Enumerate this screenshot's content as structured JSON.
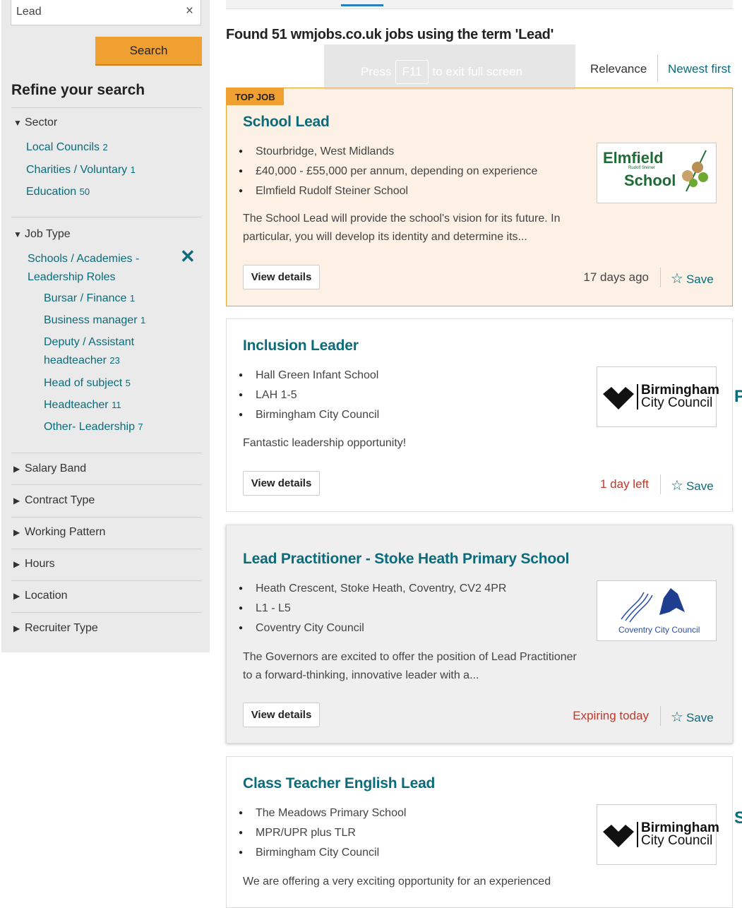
{
  "search": {
    "value": "Lead",
    "clear_icon": "×",
    "button": "Search"
  },
  "refine": {
    "title": "Refine your search",
    "sector": {
      "label": "Sector",
      "items": [
        {
          "label": "Local Councils",
          "count": "2"
        },
        {
          "label": "Charities / Voluntary",
          "count": "1"
        },
        {
          "label": "Education",
          "count": "50"
        }
      ]
    },
    "job_type": {
      "label": "Job Type",
      "selected": "Schools / Academies - Leadership Roles",
      "items": [
        {
          "label": "Bursar / Finance",
          "count": "1"
        },
        {
          "label": "Business manager",
          "count": "1"
        },
        {
          "label": "Deputy / Assistant headteacher",
          "count": "23"
        },
        {
          "label": "Head of subject",
          "count": "5"
        },
        {
          "label": "Headteacher",
          "count": "11"
        },
        {
          "label": "Other- Leadership",
          "count": "7"
        }
      ]
    },
    "collapsed": [
      "Salary Band",
      "Contract Type",
      "Working Pattern",
      "Hours",
      "Location",
      "Recruiter Type"
    ]
  },
  "results": {
    "found_text": "Found 51 wmjobs.co.uk jobs using the term 'Lead'",
    "sort_relevance": "Relevance",
    "sort_newest": "Newest first"
  },
  "fullscreen": {
    "press": "Press",
    "key": "F11",
    "rest": "to exit full screen"
  },
  "jobs": [
    {
      "badge": "TOP JOB",
      "title": "School Lead",
      "bullets": [
        "Stourbridge, West Midlands",
        "£40,000 - £55,000 per annum, depending on experience",
        "Elmfield Rudolf Steiner School"
      ],
      "description": "The School Lead will provide the school's vision for its future. In particular, you will develop its identity and determine its...",
      "view": "View details",
      "status": "17 days ago",
      "save": "Save",
      "logo": {
        "line1": "Elmfield",
        "line2": "Rudolf Steiner",
        "line3": "School"
      }
    },
    {
      "title": "Inclusion Leader",
      "bullets": [
        "Hall Green Infant School",
        "LAH 1-5",
        "Birmingham City Council"
      ],
      "description": "Fantastic leadership opportunity!",
      "view": "View details",
      "status": "1 day left",
      "save": "Save",
      "logo": {
        "line1": "Birmingham",
        "line2": "City Council"
      }
    },
    {
      "title": "Lead Practitioner - Stoke Heath Primary School",
      "bullets": [
        "Heath Crescent, Stoke Heath, Coventry, CV2 4PR",
        "L1 - L5",
        "Coventry City Council"
      ],
      "description": "The Governors are excited to offer the position of Lead Practitioner to a forward-thinking, innovative leader with a...",
      "view": "View details",
      "status": "Expiring today",
      "save": "Save",
      "logo": {
        "line1": "Coventry City Council"
      }
    },
    {
      "title": "Class Teacher English Lead",
      "bullets": [
        "The Meadows Primary School",
        "MPR/UPR plus TLR",
        "Birmingham City Council"
      ],
      "description": "We are offering a very exciting opportunity for an experienced",
      "logo": {
        "line1": "Birmingham",
        "line2": "City Council"
      }
    }
  ],
  "edge_letters": [
    "P",
    "S"
  ],
  "colors": {
    "accent": "#0a6c7a",
    "top_job": "#f0a030",
    "urgent": "#c0392b"
  }
}
